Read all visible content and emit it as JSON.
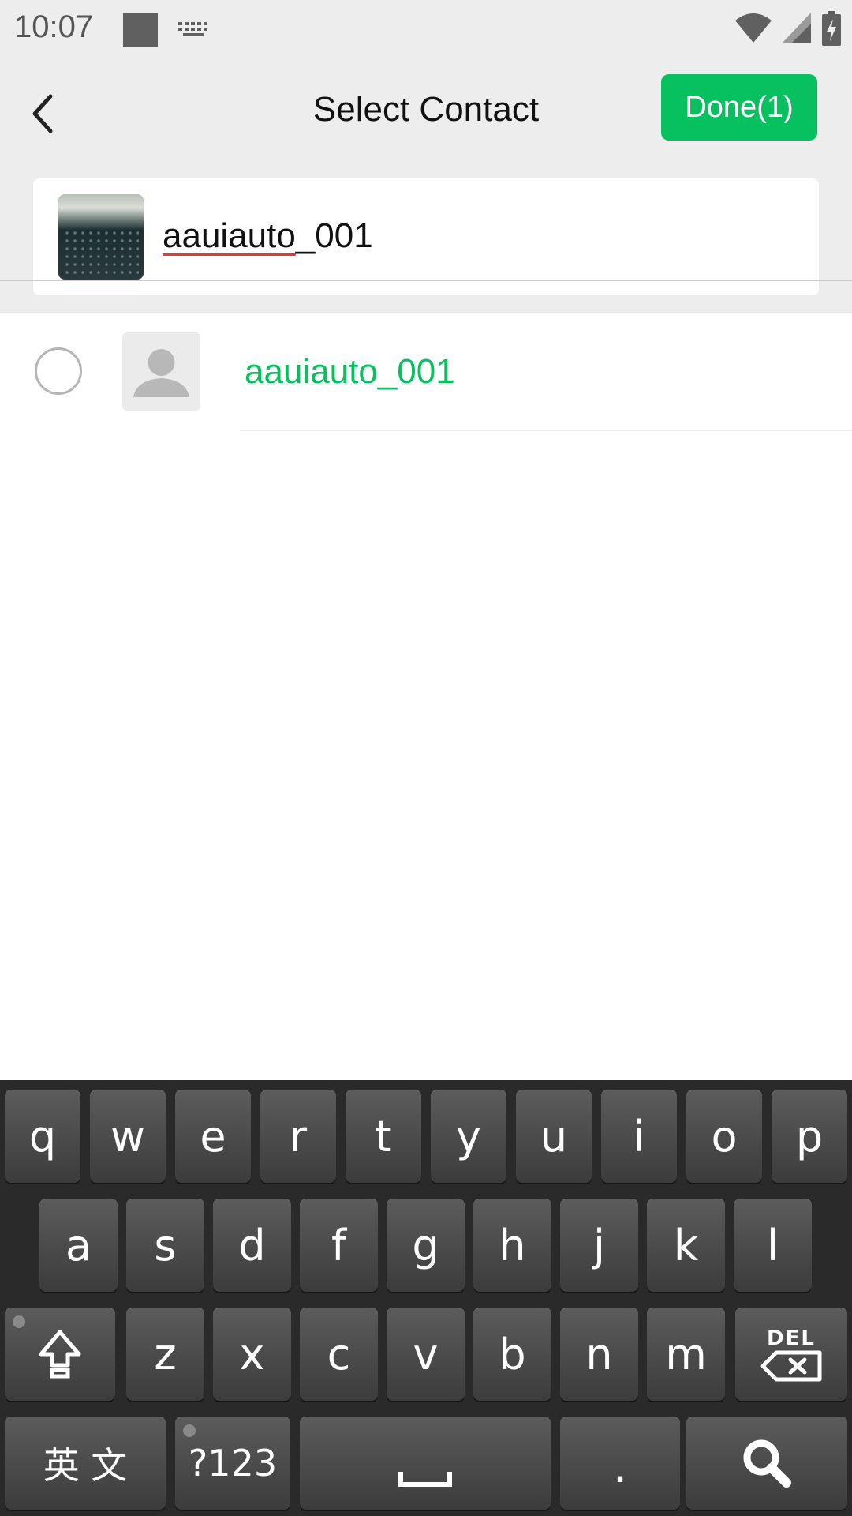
{
  "status_bar": {
    "time": "10:07",
    "icons": [
      "notification-square-icon",
      "keyboard-icon",
      "wifi-icon",
      "signal-icon",
      "battery-charging-icon"
    ]
  },
  "header": {
    "title": "Select Contact",
    "done_label": "Done(1)",
    "accent_color": "#07c160"
  },
  "search": {
    "query_underlined": "aauiauto",
    "query_rest": "_001"
  },
  "results": [
    {
      "name": "aauiauto_001",
      "selected": false
    }
  ],
  "keyboard": {
    "row1": [
      "q",
      "w",
      "e",
      "r",
      "t",
      "y",
      "u",
      "i",
      "o",
      "p"
    ],
    "row2": [
      "a",
      "s",
      "d",
      "f",
      "g",
      "h",
      "j",
      "k",
      "l"
    ],
    "row3": [
      "z",
      "x",
      "c",
      "v",
      "b",
      "n",
      "m"
    ],
    "lang_label": "英 文",
    "symbols_label": "?123",
    "period_label": ".",
    "del_label": "DEL"
  }
}
